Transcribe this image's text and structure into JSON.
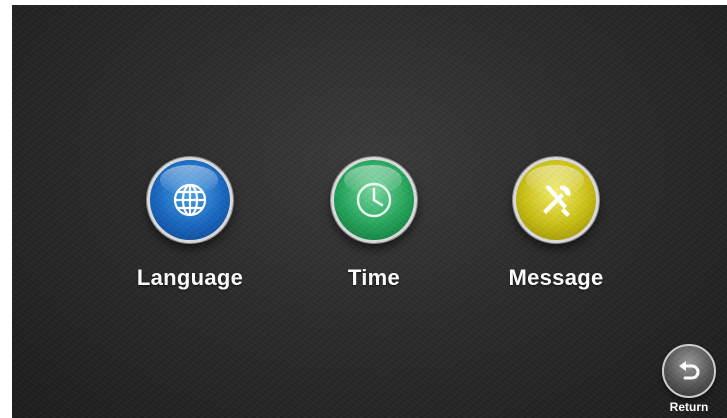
{
  "menu": {
    "items": [
      {
        "label": "Language",
        "icon": "globe-icon",
        "color": "#1766c0"
      },
      {
        "label": "Time",
        "icon": "clock-icon",
        "color": "#22a35a"
      },
      {
        "label": "Message",
        "icon": "wrench-screwdriver-icon",
        "color": "#c9be12"
      }
    ]
  },
  "return_button": {
    "label": "Return",
    "icon": "return-arrow-icon"
  }
}
